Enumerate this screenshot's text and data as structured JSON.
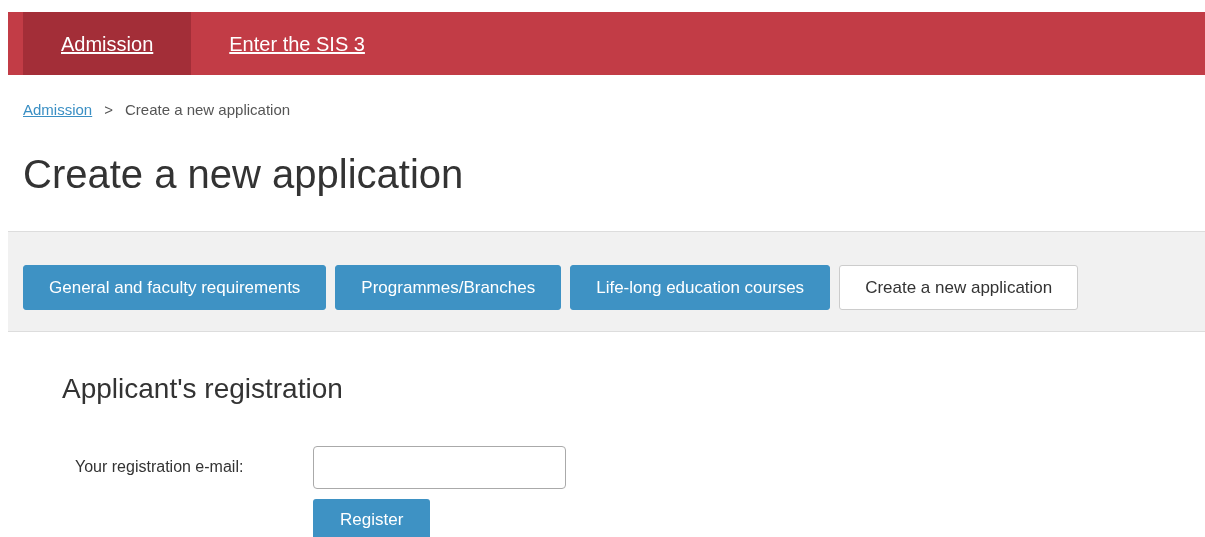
{
  "navbar": {
    "items": [
      {
        "label": "Admission",
        "selected": true
      },
      {
        "label": "Enter the SIS 3",
        "selected": false
      }
    ]
  },
  "breadcrumb": [
    {
      "label": "Admission",
      "kind": "link"
    },
    {
      "label": ">",
      "kind": "separator"
    },
    {
      "label": "Create a new application",
      "kind": "current"
    }
  ],
  "page_title": "Create a new application",
  "tabs": [
    {
      "label": "General and faculty requirements",
      "selected": false
    },
    {
      "label": "Programmes/Branches",
      "selected": false
    },
    {
      "label": "Life-long education courses",
      "selected": false
    },
    {
      "label": "Create a new application",
      "selected": true
    }
  ],
  "section_title": "Applicant's registration",
  "form": {
    "email_label": "Your registration e-mail:",
    "submit": "Register"
  }
}
